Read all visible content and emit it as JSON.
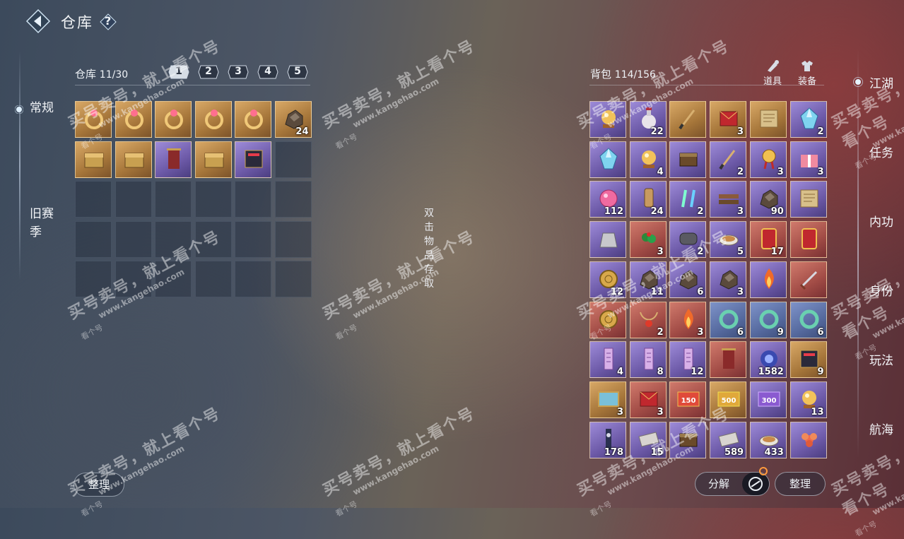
{
  "header": {
    "title": "仓库",
    "help": "?"
  },
  "left_nav": {
    "items": [
      {
        "label": "常规",
        "active": true
      },
      {
        "label": "旧赛季",
        "active": false
      }
    ]
  },
  "warehouse": {
    "label": "仓库",
    "count": "11/30",
    "pages": [
      "1",
      "2",
      "3",
      "4",
      "5"
    ],
    "active_page": "1",
    "items": [
      {
        "icon": "ring-icon",
        "rarity": "gold",
        "qty": ""
      },
      {
        "icon": "ring-icon",
        "rarity": "gold",
        "qty": ""
      },
      {
        "icon": "ring-icon",
        "rarity": "gold",
        "qty": ""
      },
      {
        "icon": "ring-icon",
        "rarity": "gold",
        "qty": ""
      },
      {
        "icon": "ring-icon",
        "rarity": "gold",
        "qty": ""
      },
      {
        "icon": "ore-icon",
        "rarity": "gold",
        "qty": "24"
      },
      {
        "icon": "chest-icon",
        "rarity": "gold",
        "qty": ""
      },
      {
        "icon": "chest-icon",
        "rarity": "gold",
        "qty": ""
      },
      {
        "icon": "scroll-icon",
        "rarity": "purple",
        "qty": ""
      },
      {
        "icon": "chest-icon",
        "rarity": "gold",
        "qty": ""
      },
      {
        "icon": "book-icon",
        "rarity": "purple",
        "qty": ""
      }
    ]
  },
  "hint": "双击物品存取",
  "bag": {
    "label": "背包",
    "count": "114/156",
    "tabs": [
      {
        "label": "道具",
        "icon": "items-icon"
      },
      {
        "label": "装备",
        "icon": "equipment-icon"
      }
    ],
    "items": [
      {
        "icon": "orb-icon",
        "rarity": "purple",
        "qty": ""
      },
      {
        "icon": "bottle-icon",
        "rarity": "purple",
        "qty": "22"
      },
      {
        "icon": "brush-icon",
        "rarity": "gold",
        "qty": ""
      },
      {
        "icon": "envelope-icon",
        "rarity": "gold",
        "qty": "3"
      },
      {
        "icon": "document-icon",
        "rarity": "gold",
        "qty": ""
      },
      {
        "icon": "crystal-icon",
        "rarity": "purple",
        "qty": "2"
      },
      {
        "icon": "crystal-icon",
        "rarity": "purple",
        "qty": ""
      },
      {
        "icon": "orb-icon",
        "rarity": "purple",
        "qty": "4"
      },
      {
        "icon": "box-icon",
        "rarity": "purple",
        "qty": ""
      },
      {
        "icon": "brush-icon",
        "rarity": "purple",
        "qty": "2"
      },
      {
        "icon": "medal-icon",
        "rarity": "purple",
        "qty": "3"
      },
      {
        "icon": "gift-icon",
        "rarity": "purple",
        "qty": "3"
      },
      {
        "icon": "candy-icon",
        "rarity": "purple",
        "qty": "112"
      },
      {
        "icon": "tag-icon",
        "rarity": "purple",
        "qty": "24"
      },
      {
        "icon": "glowstick-icon",
        "rarity": "purple",
        "qty": "2"
      },
      {
        "icon": "lumber-icon",
        "rarity": "purple",
        "qty": "3"
      },
      {
        "icon": "ore-icon",
        "rarity": "purple",
        "qty": "90"
      },
      {
        "icon": "document-icon",
        "rarity": "purple",
        "qty": ""
      },
      {
        "icon": "pouch-icon",
        "rarity": "purple",
        "qty": ""
      },
      {
        "icon": "herb-icon",
        "rarity": "red",
        "qty": "3"
      },
      {
        "icon": "log-icon",
        "rarity": "purple",
        "qty": "2"
      },
      {
        "icon": "bowl-icon",
        "rarity": "purple",
        "qty": "5"
      },
      {
        "icon": "token-icon",
        "rarity": "red",
        "qty": "17"
      },
      {
        "icon": "token-icon",
        "rarity": "red",
        "qty": ""
      },
      {
        "icon": "coin-icon",
        "rarity": "purple",
        "qty": "12"
      },
      {
        "icon": "ore-icon",
        "rarity": "purple",
        "qty": "11"
      },
      {
        "icon": "ore-icon",
        "rarity": "purple",
        "qty": "6"
      },
      {
        "icon": "ore-icon",
        "rarity": "purple",
        "qty": "3"
      },
      {
        "icon": "flame-icon",
        "rarity": "purple",
        "qty": ""
      },
      {
        "icon": "sword-icon",
        "rarity": "red",
        "qty": ""
      },
      {
        "icon": "coin-icon",
        "rarity": "red",
        "qty": ""
      },
      {
        "icon": "necklace-icon",
        "rarity": "red",
        "qty": "2"
      },
      {
        "icon": "flame-icon",
        "rarity": "red",
        "qty": "3"
      },
      {
        "icon": "jade-icon",
        "rarity": "blue",
        "qty": "6"
      },
      {
        "icon": "jade-icon",
        "rarity": "blue",
        "qty": "9"
      },
      {
        "icon": "jade-icon",
        "rarity": "blue",
        "qty": "6"
      },
      {
        "icon": "talisman-icon",
        "rarity": "purple",
        "qty": "4"
      },
      {
        "icon": "talisman-icon",
        "rarity": "purple",
        "qty": "8"
      },
      {
        "icon": "talisman-icon",
        "rarity": "purple",
        "qty": "12"
      },
      {
        "icon": "scroll-icon",
        "rarity": "red",
        "qty": ""
      },
      {
        "icon": "portal-icon",
        "rarity": "purple",
        "qty": "1582"
      },
      {
        "icon": "book-icon",
        "rarity": "gold",
        "qty": "9"
      },
      {
        "icon": "map-icon",
        "rarity": "gold",
        "qty": "3"
      },
      {
        "icon": "envelope-icon",
        "rarity": "red",
        "qty": "3"
      },
      {
        "icon": "voucher-150-icon",
        "rarity": "red",
        "qty": ""
      },
      {
        "icon": "voucher-500-icon",
        "rarity": "gold",
        "qty": ""
      },
      {
        "icon": "voucher-300-icon",
        "rarity": "purple",
        "qty": ""
      },
      {
        "icon": "orb-icon",
        "rarity": "purple",
        "qty": "13"
      },
      {
        "icon": "fan-icon",
        "rarity": "purple",
        "qty": "178"
      },
      {
        "icon": "cloth-icon",
        "rarity": "purple",
        "qty": "15"
      },
      {
        "icon": "box-icon",
        "rarity": "purple",
        "qty": ""
      },
      {
        "icon": "cloth-icon",
        "rarity": "purple",
        "qty": "589"
      },
      {
        "icon": "bowl-icon",
        "rarity": "purple",
        "qty": "433"
      },
      {
        "icon": "flower-icon",
        "rarity": "purple",
        "qty": ""
      }
    ]
  },
  "right_nav": {
    "items": [
      "江湖",
      "任务",
      "内功",
      "身份",
      "玩法",
      "航海"
    ],
    "active": "江湖"
  },
  "buttons": {
    "sort_left": "整理",
    "decompose": "分解",
    "sort_right": "整理"
  },
  "watermark": {
    "line1": "买号卖号，就上看个号",
    "line2": "www.kangehao.com",
    "line3": "看个号"
  },
  "colors": {
    "gold": "#b78446",
    "purple": "#6d5aa8",
    "blue": "#566a9f",
    "red": "#a24c46"
  }
}
